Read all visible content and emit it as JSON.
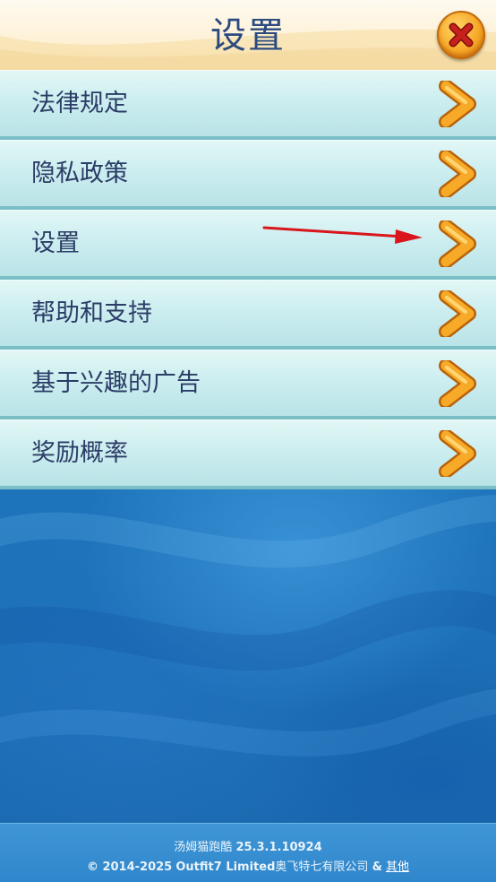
{
  "header": {
    "title": "设置",
    "close_icon": "close-x-icon"
  },
  "menu": {
    "items": [
      {
        "label": "法律规定",
        "icon": "chevron-right-icon"
      },
      {
        "label": "隐私政策",
        "icon": "chevron-right-icon"
      },
      {
        "label": "设置",
        "icon": "chevron-right-icon"
      },
      {
        "label": "帮助和支持",
        "icon": "chevron-right-icon"
      },
      {
        "label": "基于兴趣的广告",
        "icon": "chevron-right-icon"
      },
      {
        "label": "奖励概率",
        "icon": "chevron-right-icon"
      }
    ]
  },
  "footer": {
    "app_name": "汤姆猫跑酷",
    "version": "25.3.1.10924",
    "copyright": "© 2014-2025",
    "company_en": "Outfit7 Limited",
    "company_cn": "奥飞特七有限公司",
    "amp": "&",
    "other_link": "其他"
  },
  "colors": {
    "title": "#2b4a80",
    "item_text": "#2b3c66",
    "item_bg": "#cdeef0",
    "chevron": "#f7a928",
    "close_button": "#f7a928",
    "close_x": "#c8201c",
    "annotation_arrow": "#d9161b",
    "background": "#1f78bf"
  }
}
